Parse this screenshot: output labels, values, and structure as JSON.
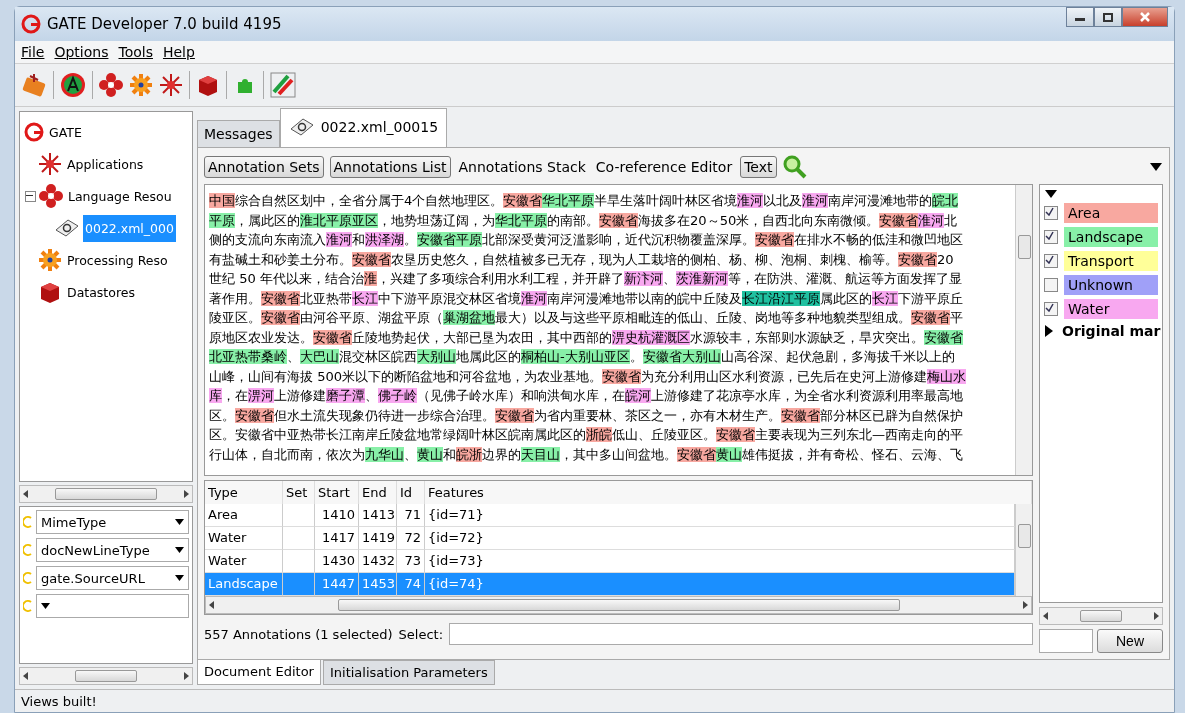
{
  "window": {
    "title": "GATE Developer 7.0 build 4195"
  },
  "menu": [
    "File",
    "Options",
    "Tools",
    "Help"
  ],
  "tree": {
    "label": "GATE",
    "kind": "root",
    "children": [
      {
        "label": "Applications",
        "kind": "applications"
      },
      {
        "label": "Language Resou",
        "kind": "language",
        "expanded": true,
        "children": [
          {
            "label": "0022.xml_000",
            "kind": "document",
            "selected": true
          }
        ]
      },
      {
        "label": "Processing Reso",
        "kind": "processing"
      },
      {
        "label": "Datastores",
        "kind": "datastores"
      }
    ]
  },
  "features": [
    {
      "name": "MimeType"
    },
    {
      "name": "docNewLineType"
    },
    {
      "name": "gate.SourceURL"
    }
  ],
  "tabs": [
    {
      "label": "Messages",
      "selected": false
    },
    {
      "label": "0022.xml_00015",
      "selected": true
    }
  ],
  "view_buttons": [
    {
      "label": "Annotation Sets",
      "kind": "button"
    },
    {
      "label": "Annotations List",
      "kind": "button"
    },
    {
      "label": "Annotations Stack",
      "kind": "label"
    },
    {
      "label": "Co-reference Editor",
      "kind": "label"
    },
    {
      "label": "Text",
      "kind": "button"
    }
  ],
  "document_lines": [
    [
      {
        "text": "中国",
        "color": "#f8a8a0"
      },
      {
        "text": "综合自然区划中，全省分属于4个自然地理区。"
      },
      {
        "text": "安徽省",
        "color": "#f8a8a0"
      },
      {
        "text": "华北平原",
        "color": "#88f0a8"
      },
      {
        "text": "半旱生落叶阔叶林区省境"
      },
      {
        "text": "淮河",
        "color": "#f8a8f0"
      },
      {
        "text": "以北及"
      },
      {
        "text": "淮河",
        "color": "#f8a8f0"
      },
      {
        "text": "南岸河漫滩地带的"
      },
      {
        "text": "皖北",
        "color": "#88f0a8"
      }
    ],
    [
      {
        "text": "平原",
        "color": "#88f0a8"
      },
      {
        "text": "，属此区的"
      },
      {
        "text": "淮北平原亚区",
        "color": "#88f0a8"
      },
      {
        "text": "，地势坦荡辽阔，为"
      },
      {
        "text": "华北平原",
        "color": "#88f0a8"
      },
      {
        "text": "的南部。"
      },
      {
        "text": "安徽省",
        "color": "#f8a8a0"
      },
      {
        "text": "海拔多在20～50米，自西北向东南微倾。"
      },
      {
        "text": "安徽省",
        "color": "#f8a8a0"
      },
      {
        "text": "淮河",
        "color": "#f8a8f0"
      },
      {
        "text": "北"
      }
    ],
    [
      {
        "text": "侧的支流向东南流入"
      },
      {
        "text": "淮河",
        "color": "#f8a8f0"
      },
      {
        "text": "和"
      },
      {
        "text": "洪泽湖",
        "color": "#f8a8f0"
      },
      {
        "text": "。"
      },
      {
        "text": "安徽省平原",
        "color": "#88f0a8"
      },
      {
        "text": "北部深受黄河泛滥影响，近代沉积物覆盖深厚。"
      },
      {
        "text": "安徽省",
        "color": "#f8a8a0"
      },
      {
        "text": "在排水不畅的低洼和微凹地区"
      }
    ],
    [
      {
        "text": "有盐碱土和砂姜土分布。"
      },
      {
        "text": "安徽省",
        "color": "#f8a8a0"
      },
      {
        "text": "农垦历史悠久，自然植被多已无存，现为人工栽培的侧柏、杨、柳、泡桐、刺槐、榆等。"
      },
      {
        "text": "安徽省",
        "color": "#f8a8a0"
      },
      {
        "text": "20"
      }
    ],
    [
      {
        "text": "世纪 50 年代以来，结合治"
      },
      {
        "text": "淮",
        "color": "#f8a8a0"
      },
      {
        "text": "，兴建了多项综合利用水利工程，并开辟了"
      },
      {
        "text": "新汴河",
        "color": "#f8a8f0"
      },
      {
        "text": "、"
      },
      {
        "text": "茨淮新河",
        "color": "#f8a8f0"
      },
      {
        "text": "等，在防洪、灌溉、航运等方面发挥了显"
      }
    ],
    [
      {
        "text": "著作用。"
      },
      {
        "text": "安徽省",
        "color": "#f8a8a0"
      },
      {
        "text": "北亚热带"
      },
      {
        "text": "长江",
        "color": "#f8a8f0"
      },
      {
        "text": "中下游平原混交林区省境"
      },
      {
        "text": "淮河",
        "color": "#f8a8f0"
      },
      {
        "text": "南岸河漫滩地带以南的皖中丘陵及"
      },
      {
        "text": "长江沿江平原",
        "color": "#20c0a0"
      },
      {
        "text": "属此区的"
      },
      {
        "text": "长江",
        "color": "#f8a8f0"
      },
      {
        "text": "下游平原丘"
      }
    ],
    [
      {
        "text": "陵亚区。"
      },
      {
        "text": "安徽省",
        "color": "#f8a8a0"
      },
      {
        "text": "由河谷平原、湖盆平原（"
      },
      {
        "text": "巢湖盆地",
        "color": "#88f0a8"
      },
      {
        "text": "最大）以及与这些平原相毗连的低山、丘陵、岗地等多种地貌类型组成。"
      },
      {
        "text": "安徽省",
        "color": "#f8a8a0"
      },
      {
        "text": "平"
      }
    ],
    [
      {
        "text": "原地区农业发达。"
      },
      {
        "text": "安徽省",
        "color": "#f8a8a0"
      },
      {
        "text": "丘陵地势起伏，大部已垦为农田，其中西部的"
      },
      {
        "text": "淠史杭灌溉区",
        "color": "#f8a8f0"
      },
      {
        "text": "水源较丰，东部则水源缺乏，旱灾突出。"
      },
      {
        "text": "安徽省",
        "color": "#88f0a8"
      }
    ],
    [
      {
        "text": "北亚热带桑岭",
        "color": "#88f0a8"
      },
      {
        "text": "、"
      },
      {
        "text": "大巴山",
        "color": "#88f0a8"
      },
      {
        "text": "混交林区皖西"
      },
      {
        "text": "大别山",
        "color": "#88f0a8"
      },
      {
        "text": "地属此区的"
      },
      {
        "text": "桐柏山-大别山亚区",
        "color": "#88f0a8"
      },
      {
        "text": "。"
      },
      {
        "text": "安徽省大别山",
        "color": "#88f0a8"
      },
      {
        "text": "山高谷深、起伏急剧，多海拔千米以上的"
      }
    ],
    [
      {
        "text": "山峰，山间有海拔 500米以下的断陷盆地和河谷盆地，为农业基地。"
      },
      {
        "text": "安徽省",
        "color": "#f8a8a0"
      },
      {
        "text": "为充分利用山区水利资源，已先后在史河上游修建"
      },
      {
        "text": "梅山水",
        "color": "#f8a8f0"
      }
    ],
    [
      {
        "text": "库",
        "color": "#f8a8f0"
      },
      {
        "text": "，在"
      },
      {
        "text": "淠河",
        "color": "#f8a8f0"
      },
      {
        "text": "上游修建"
      },
      {
        "text": "磨子潭",
        "color": "#f8a8f0"
      },
      {
        "text": "、"
      },
      {
        "text": "佛子岭",
        "color": "#f8a8f0"
      },
      {
        "text": "（见佛子岭水库）和响洪甸水库，在"
      },
      {
        "text": "皖河",
        "color": "#f8a8f0"
      },
      {
        "text": "上游修建了花凉亭水库，为全省水利资源利用率最高地"
      }
    ],
    [
      {
        "text": "区。"
      },
      {
        "text": "安徽省",
        "color": "#f8a8a0"
      },
      {
        "text": "但水土流失现象仍待进一步综合治理。"
      },
      {
        "text": "安徽省",
        "color": "#f8a8a0"
      },
      {
        "text": "为省内重要林、茶区之一，亦有木材生产。"
      },
      {
        "text": "安徽省",
        "color": "#f8a8a0"
      },
      {
        "text": "部分林区已辟为自然保护"
      }
    ],
    [
      {
        "text": "区。安徽省中亚热带长江南岸丘陵盆地常绿阔叶林区皖南属此区的"
      },
      {
        "text": "浙皖",
        "color": "#f8a8a0"
      },
      {
        "text": "低山、丘陵亚区。"
      },
      {
        "text": "安徽省",
        "color": "#f8a8a0"
      },
      {
        "text": "主要表现为三列东北—西南走向的平"
      }
    ],
    [
      {
        "text": "行山体，自北而南，依次为"
      },
      {
        "text": "九华山",
        "color": "#88f0a8"
      },
      {
        "text": "、"
      },
      {
        "text": "黄山",
        "color": "#88f0a8"
      },
      {
        "text": "和"
      },
      {
        "text": "皖浙",
        "color": "#f8a8a0"
      },
      {
        "text": "边界的"
      },
      {
        "text": "天目山",
        "color": "#88f0a8"
      },
      {
        "text": "，其中多山间盆地。"
      },
      {
        "text": "安徽省",
        "color": "#f8a8a0"
      },
      {
        "text": "黄山",
        "color": "#88f0a8"
      },
      {
        "text": "雄伟挺拔，并有奇松、怪石、云海、飞"
      }
    ]
  ],
  "legend": [
    {
      "label": "Area",
      "color": "#f8a8a0",
      "checked": true
    },
    {
      "label": "Landscape",
      "color": "#88f0a8",
      "checked": true
    },
    {
      "label": "Transport",
      "color": "#ffff99",
      "checked": true
    },
    {
      "label": "Unknown",
      "color": "#a0a0f8",
      "checked": false
    },
    {
      "label": "Water",
      "color": "#f8a8f0",
      "checked": true
    }
  ],
  "legend_group": {
    "label": "Original mar",
    "expanded": false
  },
  "table": {
    "columns": [
      "Type",
      "Set",
      "Start",
      "End",
      "Id",
      "Features"
    ],
    "rows": [
      {
        "cells": [
          "Area",
          "",
          "1410",
          "1413",
          "71",
          "{id=71}"
        ],
        "selected": false
      },
      {
        "cells": [
          "Water",
          "",
          "1417",
          "1419",
          "72",
          "{id=72}"
        ],
        "selected": false
      },
      {
        "cells": [
          "Water",
          "",
          "1430",
          "1432",
          "73",
          "{id=73}"
        ],
        "selected": false
      },
      {
        "cells": [
          "Landscape",
          "",
          "1447",
          "1453",
          "74",
          "{id=74}"
        ],
        "selected": true
      }
    ]
  },
  "annotation_count": "557 Annotations (1 selected)",
  "select_label": "Select:",
  "new_button": "New",
  "bottom_tabs": [
    {
      "label": "Document Editor",
      "selected": true
    },
    {
      "label": "Initialisation Parameters",
      "selected": false
    }
  ],
  "status_bar": "Views built!"
}
